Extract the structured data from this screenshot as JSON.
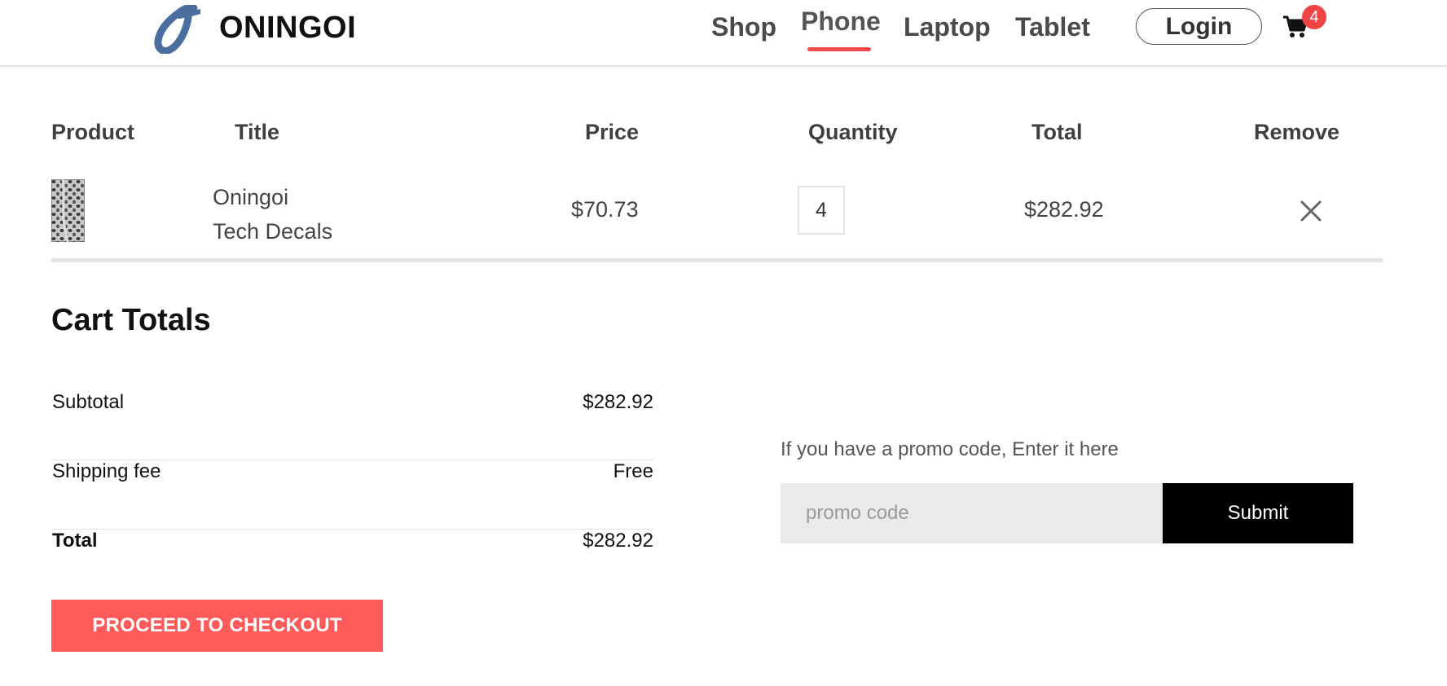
{
  "header": {
    "brand": "ONINGOI",
    "logo_icon": "oningoi-logo-icon",
    "nav": [
      {
        "label": "Shop",
        "active": false
      },
      {
        "label": "Phone",
        "active": true
      },
      {
        "label": "Laptop",
        "active": false
      },
      {
        "label": "Tablet",
        "active": false
      }
    ],
    "login_label": "Login",
    "cart_icon": "cart-icon",
    "cart_count": "4",
    "accent_color": "#ef4b4b",
    "logo_color": "#4a6f9e"
  },
  "cart_table": {
    "headers": {
      "product": "Product",
      "title": "Title",
      "price": "Price",
      "quantity": "Quantity",
      "total": "Total",
      "remove": "Remove"
    },
    "items": [
      {
        "title_line1": "Oningoi",
        "title_line2": "Tech Decals",
        "price": "$70.73",
        "quantity": "4",
        "total": "$282.92",
        "remove_icon": "close-icon"
      }
    ]
  },
  "cart_totals": {
    "heading": "Cart Totals",
    "subtotal_label": "Subtotal",
    "subtotal_value": "$282.92",
    "shipping_label": "Shipping fee",
    "shipping_value": "Free",
    "total_label": "Total",
    "total_value": "$282.92",
    "checkout_label": "PROCEED TO CHECKOUT",
    "checkout_color": "#ff5a5a"
  },
  "promo": {
    "label": "If you have a promo code, Enter it here",
    "placeholder": "promo code",
    "value": "",
    "submit_label": "Submit"
  }
}
